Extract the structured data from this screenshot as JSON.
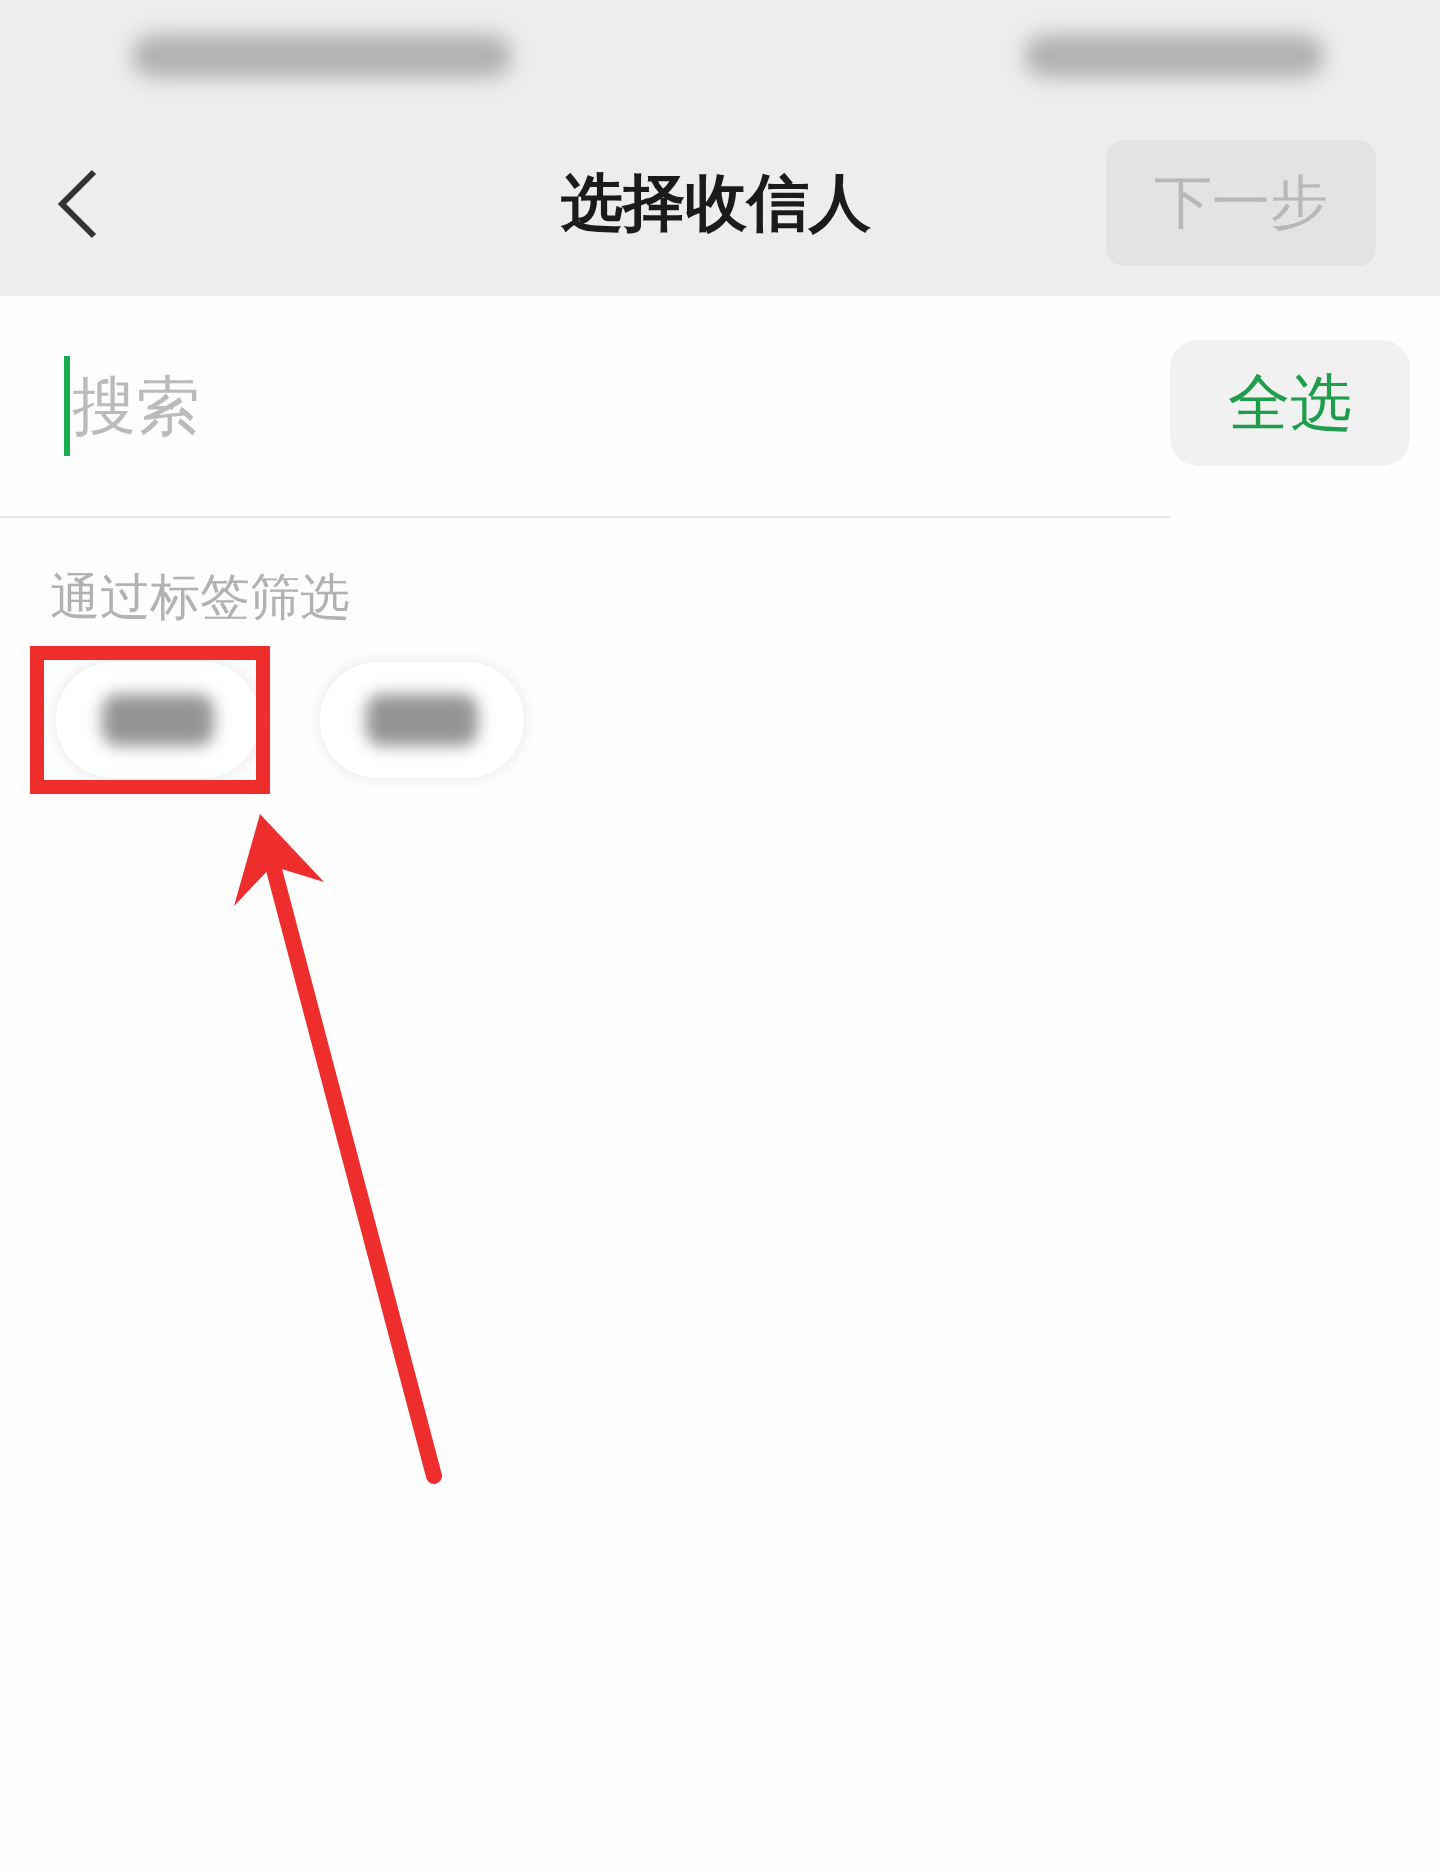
{
  "header": {
    "title": "选择收信人",
    "next_button": {
      "label": "下一步",
      "disabled": true
    }
  },
  "search": {
    "placeholder": "搜索",
    "focused": true
  },
  "select_all_button": {
    "label": "全选"
  },
  "tag_filter": {
    "label": "通过标签筛选",
    "tags": [
      {
        "kind": "blurred",
        "highlighted": true
      },
      {
        "kind": "blurred",
        "highlighted": false
      }
    ]
  }
}
